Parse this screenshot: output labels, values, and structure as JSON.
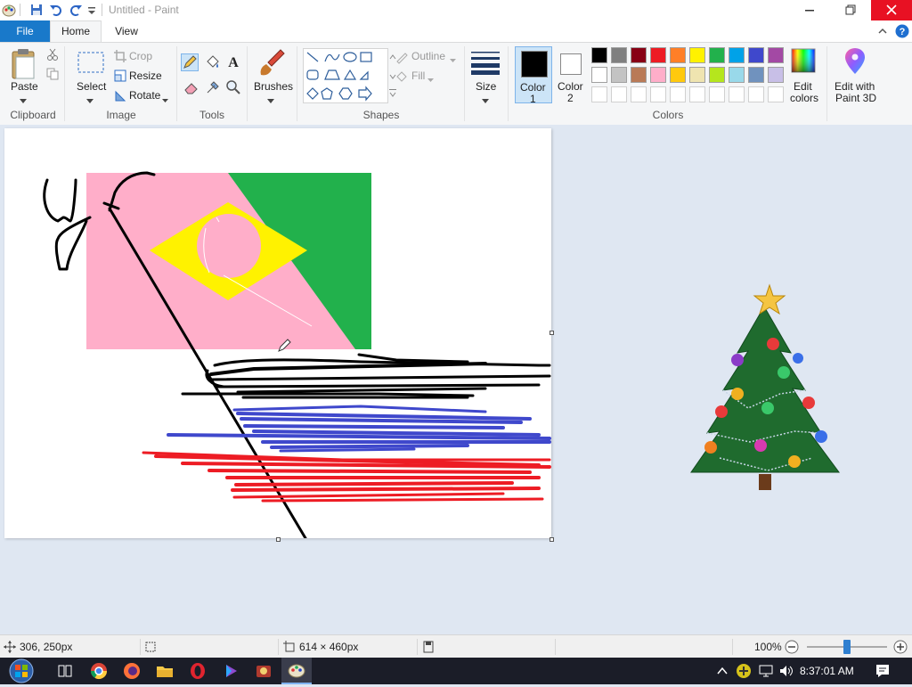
{
  "window": {
    "title": "Untitled - Paint"
  },
  "tabs": {
    "file": "File",
    "home": "Home",
    "view": "View"
  },
  "clipboard": {
    "paste": "Paste",
    "group": "Clipboard"
  },
  "image": {
    "select": "Select",
    "crop": "Crop",
    "resize": "Resize",
    "rotate": "Rotate",
    "group": "Image"
  },
  "tools": {
    "group": "Tools"
  },
  "brushes": {
    "label": "Brushes"
  },
  "shapes": {
    "outline": "Outline",
    "fill": "Fill",
    "group": "Shapes"
  },
  "size": {
    "label": "Size"
  },
  "colors": {
    "color1_label": "Color",
    "color1_num": "1",
    "color2_label": "Color",
    "color2_num": "2",
    "edit_line1": "Edit",
    "edit_line2": "colors",
    "group": "Colors",
    "paint3d_line1": "Edit with",
    "paint3d_line2": "Paint 3D",
    "color1_value": "#000000",
    "color2_value": "#ffffff",
    "palette_row1": [
      "#000000",
      "#7f7f7f",
      "#880015",
      "#ed1c24",
      "#ff7f27",
      "#fff200",
      "#22b14c",
      "#00a2e8",
      "#3f48cc",
      "#a349a4"
    ],
    "palette_row2": [
      "#ffffff",
      "#c3c3c3",
      "#b97a57",
      "#ffaec9",
      "#ffc90e",
      "#efe4b0",
      "#b5e61d",
      "#99d9ea",
      "#7092be",
      "#c8bfe7"
    ]
  },
  "status": {
    "cursor_pos": "306, 250px",
    "image_size": "614 × 460px",
    "zoom": "100%",
    "zoom_fraction": 0.5
  },
  "taskbar": {
    "time": "8:37:01 AM"
  }
}
